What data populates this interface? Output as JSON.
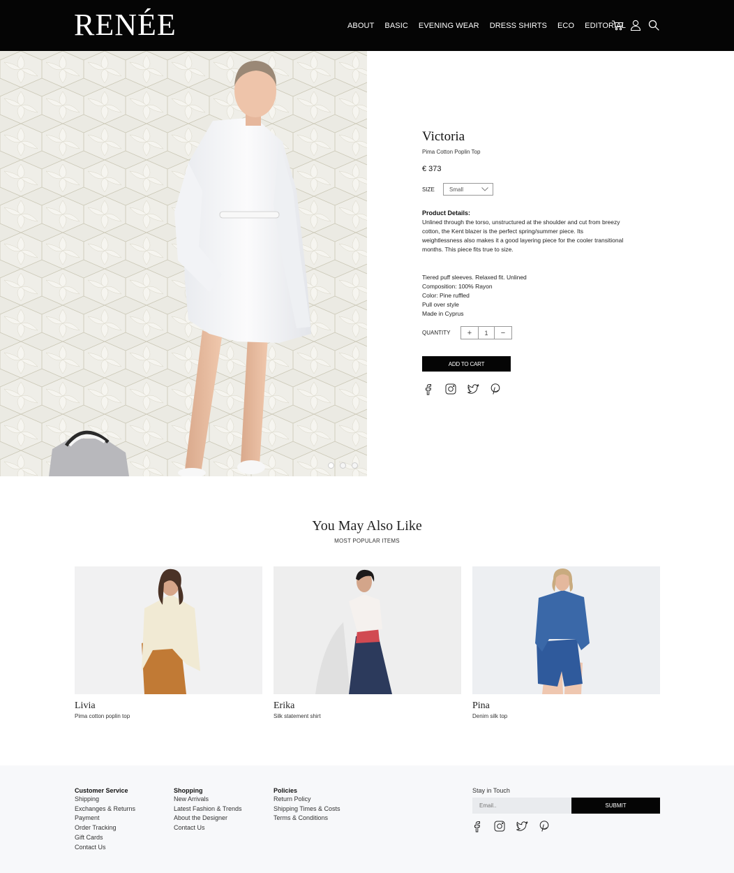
{
  "brand": {
    "logo": "RENÉE"
  },
  "nav": {
    "items": [
      "ABOUT",
      "BASIC",
      "EVENING WEAR",
      "DRESS SHIRTS",
      "ECO",
      "EDITORIAL"
    ],
    "icons": [
      "cart-icon",
      "user-icon",
      "search-icon"
    ]
  },
  "product": {
    "name": "Victoria",
    "subtitle": "Pima Cotton Poplin Top",
    "price": "€ 373",
    "size_label": "SIZE",
    "size_value": "Small",
    "details_heading": "Product Details:",
    "details": "Unlined through the torso, unstructured at the shoulder and cut from breezy cotton, the Kent blazer is the perfect spring/summer piece. Its weightlessness also makes it a good layering piece for the cooler transitional months. This piece fits true to size.",
    "specs": [
      "Tiered puff sleeves. Relaxed fit. Unlined",
      "Composition: 100% Rayon",
      "Color: Pine ruffled",
      "Pull over style",
      "Made in Cyprus"
    ],
    "quantity_label": "QUANTITY",
    "quantity": "1",
    "qty_plus": "+",
    "qty_minus": "−",
    "add_to_cart": "ADD TO CART",
    "carousel": {
      "slides": 3,
      "active": 1
    }
  },
  "related": {
    "title": "You May Also Like",
    "subtitle": "MOST POPULAR ITEMS",
    "items": [
      {
        "name": "Livia",
        "desc": "Pima cotton poplin top"
      },
      {
        "name": "Erika",
        "desc": "Silk statement shirt"
      },
      {
        "name": "Pina",
        "desc": "Denim silk top"
      }
    ]
  },
  "footer": {
    "customer_service": {
      "heading": "Customer Service",
      "links": [
        "Shipping",
        "Exchanges & Returns",
        "Payment",
        "Order Tracking",
        "Gift Cards",
        "Contact Us"
      ]
    },
    "shopping": {
      "heading": "Shopping",
      "links": [
        "New Arrivals",
        "Latest Fashion & Trends",
        "About the Designer",
        "Contact Us"
      ]
    },
    "policies": {
      "heading": "Policies",
      "links": [
        "Return Policy",
        "Shipping Times & Costs",
        "Terms & Conditions"
      ]
    },
    "newsletter": {
      "heading": "Stay in Touch",
      "placeholder": "Email..",
      "submit": "SUBMIT"
    }
  },
  "colors": {
    "header_bg": "#050505",
    "footer_bg": "#f7f8fa",
    "button_bg": "#050505"
  }
}
